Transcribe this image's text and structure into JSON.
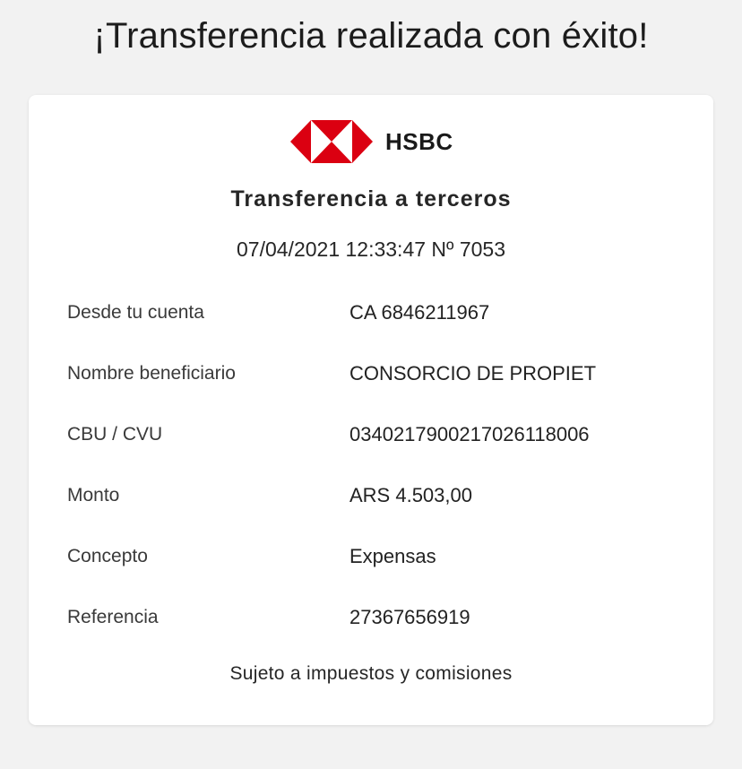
{
  "header": {
    "title": "¡Transferencia realizada con éxito!"
  },
  "receipt": {
    "brand": "HSBC",
    "brand_color": "#db0011",
    "title": "Transferencia a terceros",
    "meta": "07/04/2021 12:33:47 Nº 7053",
    "rows": [
      {
        "label": "Desde tu cuenta",
        "value": "CA 6846211967"
      },
      {
        "label": "Nombre beneficiario",
        "value": "CONSORCIO DE PROPIET"
      },
      {
        "label": "CBU / CVU",
        "value": "0340217900217026118006"
      },
      {
        "label": "Monto",
        "value": "ARS 4.503,00"
      },
      {
        "label": "Concepto",
        "value": "Expensas"
      },
      {
        "label": "Referencia",
        "value": "27367656919"
      }
    ],
    "footnote": "Sujeto a impuestos y comisiones"
  }
}
